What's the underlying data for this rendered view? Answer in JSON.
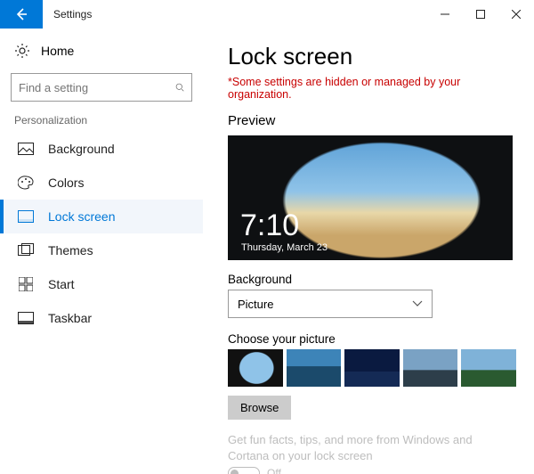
{
  "titlebar": {
    "app_title": "Settings"
  },
  "sidebar": {
    "home_label": "Home",
    "search_placeholder": "Find a setting",
    "section_label": "Personalization",
    "items": [
      {
        "label": "Background"
      },
      {
        "label": "Colors"
      },
      {
        "label": "Lock screen"
      },
      {
        "label": "Themes"
      },
      {
        "label": "Start"
      },
      {
        "label": "Taskbar"
      }
    ]
  },
  "main": {
    "heading": "Lock screen",
    "org_note": "*Some settings are hidden or managed by your organization.",
    "preview_label": "Preview",
    "preview_time": "7:10",
    "preview_date": "Thursday, March 23",
    "background_label": "Background",
    "background_value": "Picture",
    "choose_label": "Choose your picture",
    "browse_label": "Browse",
    "funfacts_label": "Get fun facts, tips, and more from Windows and Cortana on your lock screen",
    "funfacts_state": "Off"
  }
}
